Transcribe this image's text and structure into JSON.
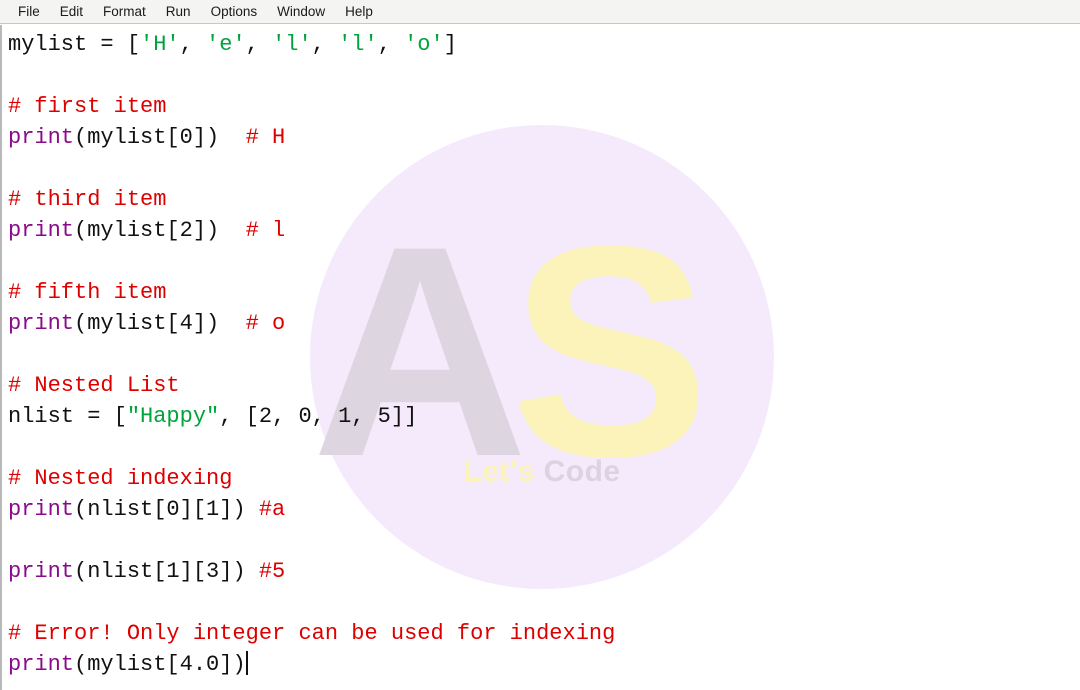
{
  "window": {
    "app": "Python IDLE Editor"
  },
  "menubar": {
    "items": [
      {
        "name": "file",
        "label": "File"
      },
      {
        "name": "edit",
        "label": "Edit"
      },
      {
        "name": "format",
        "label": "Format"
      },
      {
        "name": "run",
        "label": "Run"
      },
      {
        "name": "options",
        "label": "Options"
      },
      {
        "name": "window",
        "label": "Window"
      },
      {
        "name": "help",
        "label": "Help"
      }
    ]
  },
  "watermark": {
    "letter_a": "A",
    "letter_s": "S",
    "tagline_first": "Let's",
    "tagline_second": "Code",
    "disc_color": "#f2e6fb",
    "letter_a_color": "#ddd6e0",
    "letter_s_color": "#fbf3b9"
  },
  "syntax_colors": {
    "keyword": "#8b0a8b",
    "string": "#00a33c",
    "comment": "#dd0000",
    "plain": "#111111"
  },
  "editor": {
    "caret_present": true,
    "lines": [
      {
        "n": 1,
        "segments": [
          {
            "t": "plain",
            "v": "mylist = ["
          },
          {
            "t": "str",
            "v": "'H'"
          },
          {
            "t": "plain",
            "v": ", "
          },
          {
            "t": "str",
            "v": "'e'"
          },
          {
            "t": "plain",
            "v": ", "
          },
          {
            "t": "str",
            "v": "'l'"
          },
          {
            "t": "plain",
            "v": ", "
          },
          {
            "t": "str",
            "v": "'l'"
          },
          {
            "t": "plain",
            "v": ", "
          },
          {
            "t": "str",
            "v": "'o'"
          },
          {
            "t": "plain",
            "v": "]"
          }
        ]
      },
      {
        "n": 2,
        "segments": []
      },
      {
        "n": 3,
        "segments": [
          {
            "t": "cmt",
            "v": "# first item"
          }
        ]
      },
      {
        "n": 4,
        "segments": [
          {
            "t": "kw",
            "v": "print"
          },
          {
            "t": "plain",
            "v": "(mylist[0])  "
          },
          {
            "t": "cmt",
            "v": "# H"
          }
        ]
      },
      {
        "n": 5,
        "segments": []
      },
      {
        "n": 6,
        "segments": [
          {
            "t": "cmt",
            "v": "# third item"
          }
        ]
      },
      {
        "n": 7,
        "segments": [
          {
            "t": "kw",
            "v": "print"
          },
          {
            "t": "plain",
            "v": "(mylist[2])  "
          },
          {
            "t": "cmt",
            "v": "# l"
          }
        ]
      },
      {
        "n": 8,
        "segments": []
      },
      {
        "n": 9,
        "segments": [
          {
            "t": "cmt",
            "v": "# fifth item"
          }
        ]
      },
      {
        "n": 10,
        "segments": [
          {
            "t": "kw",
            "v": "print"
          },
          {
            "t": "plain",
            "v": "(mylist[4])  "
          },
          {
            "t": "cmt",
            "v": "# o"
          }
        ]
      },
      {
        "n": 11,
        "segments": []
      },
      {
        "n": 12,
        "segments": [
          {
            "t": "cmt",
            "v": "# Nested List"
          }
        ]
      },
      {
        "n": 13,
        "segments": [
          {
            "t": "plain",
            "v": "nlist = ["
          },
          {
            "t": "str",
            "v": "\"Happy\""
          },
          {
            "t": "plain",
            "v": ", [2, 0, 1, 5]]"
          }
        ]
      },
      {
        "n": 14,
        "segments": []
      },
      {
        "n": 15,
        "segments": [
          {
            "t": "cmt",
            "v": "# Nested indexing"
          }
        ]
      },
      {
        "n": 16,
        "segments": [
          {
            "t": "kw",
            "v": "print"
          },
          {
            "t": "plain",
            "v": "(nlist[0][1]) "
          },
          {
            "t": "cmt",
            "v": "#a"
          }
        ]
      },
      {
        "n": 17,
        "segments": []
      },
      {
        "n": 18,
        "segments": [
          {
            "t": "kw",
            "v": "print"
          },
          {
            "t": "plain",
            "v": "(nlist[1][3]) "
          },
          {
            "t": "cmt",
            "v": "#5"
          }
        ]
      },
      {
        "n": 19,
        "segments": []
      },
      {
        "n": 20,
        "segments": [
          {
            "t": "cmt",
            "v": "# Error! Only integer can be used for indexing"
          }
        ]
      },
      {
        "n": 21,
        "segments": [
          {
            "t": "kw",
            "v": "print"
          },
          {
            "t": "plain",
            "v": "(mylist[4.0])"
          }
        ],
        "caret": true
      }
    ]
  }
}
